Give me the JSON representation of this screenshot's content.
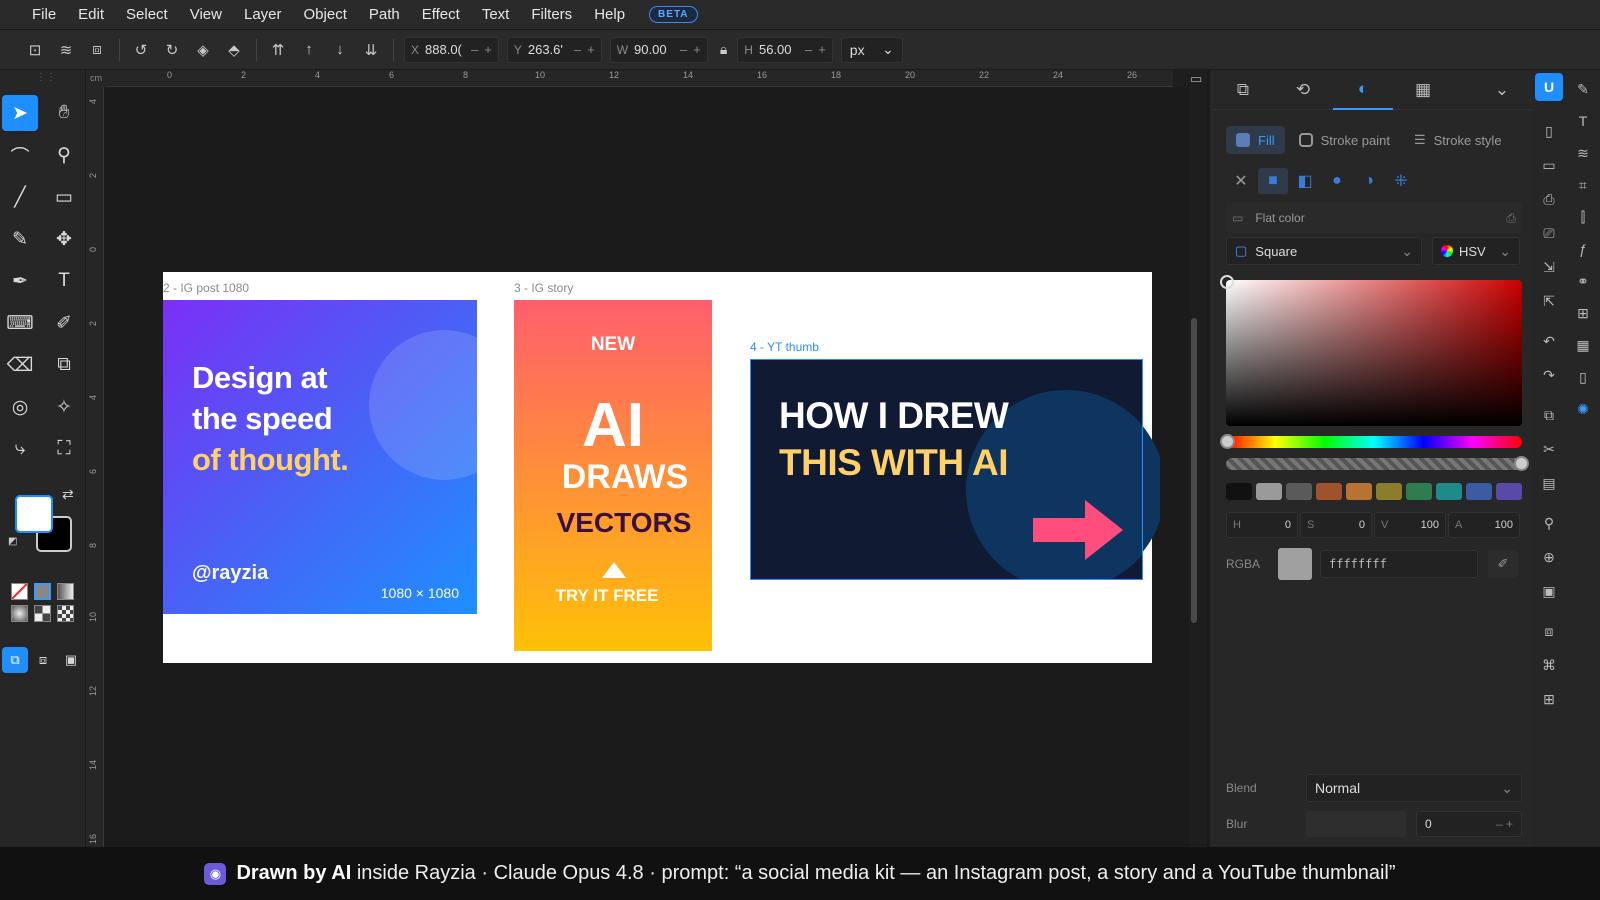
{
  "menu": [
    "File",
    "Edit",
    "Select",
    "View",
    "Layer",
    "Object",
    "Path",
    "Effect",
    "Text",
    "Filters",
    "Help"
  ],
  "beta": "BETA",
  "toolbar": {
    "x_label": "X",
    "x_value": "888.0(",
    "y_label": "Y",
    "y_value": "263.6'",
    "w_label": "W",
    "w_value": "90.00",
    "h_label": "H",
    "h_value": "56.00",
    "unit": "px",
    "minus": "–",
    "plus": "+"
  },
  "ruler": {
    "top": [
      "0",
      "2",
      "4",
      "6",
      "8",
      "10",
      "12",
      "14",
      "16",
      "18",
      "20",
      "22",
      "24",
      "26"
    ],
    "left": [
      "4",
      "2",
      "0",
      "2",
      "4",
      "6",
      "8",
      "10",
      "12",
      "14",
      "16"
    ],
    "unit": "cm"
  },
  "artboards": {
    "ig_post": {
      "label": "2 - IG post 1080",
      "line1": "Design at",
      "line2": "the speed",
      "line3": "of thought.",
      "handle": "@rayzia",
      "size": "1080 × 1080"
    },
    "ig_story": {
      "label": "3 - IG story",
      "new": "NEW",
      "ai": "AI",
      "draws": "DRAWS",
      "vectors": "VECTORS",
      "cta": "TRY IT FREE"
    },
    "yt_thumb": {
      "label": "4 - YT thumb",
      "line1": "HOW I DREW",
      "line2": "THIS WITH AI"
    }
  },
  "panel": {
    "fill_tab": "Fill",
    "stroke_paint_tab": "Stroke paint",
    "stroke_style_tab": "Stroke style",
    "flat_color": "Flat color",
    "shape": "Square",
    "mode": "HSV",
    "h_label": "H",
    "h_value": "0",
    "s_label": "S",
    "s_value": "0",
    "v_label": "V",
    "v_value": "100",
    "a_label": "A",
    "a_value": "100",
    "rgba_label": "RGBA",
    "rgba_value": "ffffffff",
    "blend_label": "Blend",
    "blend_value": "Normal",
    "blur_label": "Blur",
    "blur_value": "0"
  },
  "swatch_colors": [
    "#111111",
    "#9a9a9a",
    "#5a5a5a",
    "#a0522d",
    "#b87333",
    "#8b7d2a",
    "#2e7d4f",
    "#1f8a8a",
    "#3b5ba5",
    "#5a4aa8"
  ],
  "banner": {
    "bold": "Drawn by AI",
    "rest": " inside Rayzia · Claude Opus 4.8 · prompt: “a social media kit — an Instagram post, a story and a YouTube thumbnail”"
  }
}
